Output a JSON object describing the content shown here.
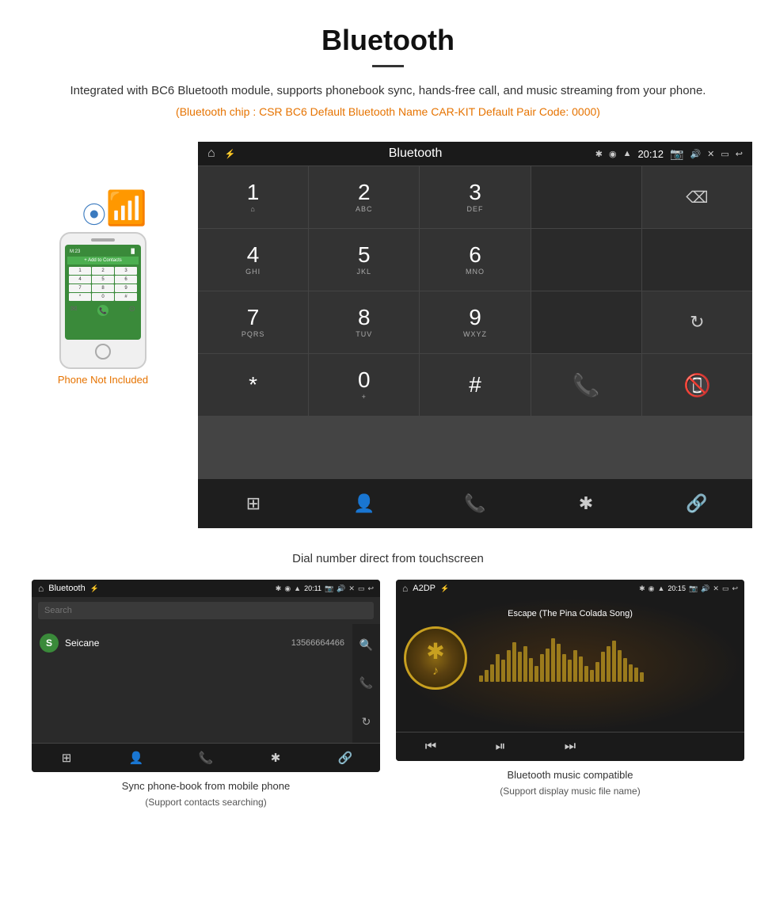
{
  "header": {
    "title": "Bluetooth",
    "description": "Integrated with BC6 Bluetooth module, supports phonebook sync, hands-free call, and music streaming from your phone.",
    "spec": "(Bluetooth chip : CSR BC6   Default Bluetooth Name CAR-KIT    Default Pair Code: 0000)"
  },
  "phone_note": "Phone Not Included",
  "car_screen": {
    "title": "Bluetooth",
    "time": "20:12",
    "dialpad": [
      {
        "number": "1",
        "letters": "⌂",
        "key": "1"
      },
      {
        "number": "2",
        "letters": "ABC",
        "key": "2"
      },
      {
        "number": "3",
        "letters": "DEF",
        "key": "3"
      },
      {
        "number": "",
        "letters": "",
        "key": "empty1"
      },
      {
        "number": "",
        "letters": "backspace",
        "key": "backspace"
      },
      {
        "number": "4",
        "letters": "GHI",
        "key": "4"
      },
      {
        "number": "5",
        "letters": "JKL",
        "key": "5"
      },
      {
        "number": "6",
        "letters": "MNO",
        "key": "6"
      },
      {
        "number": "",
        "letters": "",
        "key": "empty2"
      },
      {
        "number": "",
        "letters": "",
        "key": "empty3"
      },
      {
        "number": "7",
        "letters": "PQRS",
        "key": "7"
      },
      {
        "number": "8",
        "letters": "TUV",
        "key": "8"
      },
      {
        "number": "9",
        "letters": "WXYZ",
        "key": "9"
      },
      {
        "number": "",
        "letters": "",
        "key": "empty4"
      },
      {
        "number": "",
        "letters": "refresh",
        "key": "refresh"
      },
      {
        "number": "*",
        "letters": "",
        "key": "star"
      },
      {
        "number": "0",
        "letters": "+",
        "key": "0"
      },
      {
        "number": "#",
        "letters": "",
        "key": "hash"
      },
      {
        "number": "",
        "letters": "call",
        "key": "call"
      },
      {
        "number": "",
        "letters": "endcall",
        "key": "endcall"
      }
    ],
    "nav_items": [
      "grid",
      "person",
      "phone",
      "bluetooth",
      "link"
    ]
  },
  "dial_caption": "Dial number direct from touchscreen",
  "phonebook_screen": {
    "header_title": "Bluetooth",
    "time": "20:11",
    "search_placeholder": "Search",
    "contacts": [
      {
        "initial": "S",
        "name": "Seicane",
        "number": "13566664466"
      }
    ]
  },
  "music_screen": {
    "header_title": "A2DP",
    "time": "20:15",
    "song_title": "Escape (The Pina Colada Song)"
  },
  "captions": {
    "phonebook": "Sync phone-book from mobile phone",
    "phonebook_sub": "(Support contacts searching)",
    "music": "Bluetooth music compatible",
    "music_sub": "(Support display music file name)"
  },
  "visualizer_bars": [
    8,
    15,
    22,
    35,
    28,
    40,
    50,
    38,
    45,
    30,
    20,
    35,
    42,
    55,
    48,
    35,
    28,
    40,
    32,
    20,
    15,
    25,
    38,
    45,
    52,
    40,
    30,
    22,
    18,
    12
  ]
}
